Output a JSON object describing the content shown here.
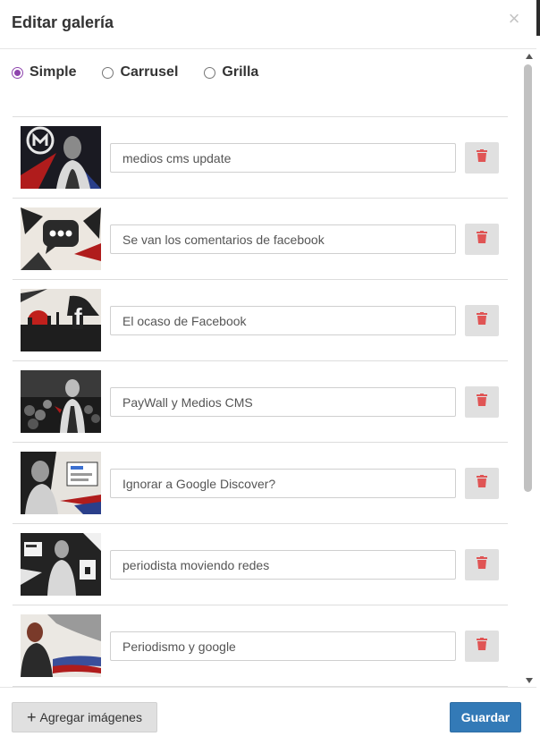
{
  "modal": {
    "title": "Editar galería",
    "close_icon": "×"
  },
  "layout_options": [
    {
      "label": "Simple",
      "checked": true
    },
    {
      "label": "Carrusel",
      "checked": false
    },
    {
      "label": "Grilla",
      "checked": false
    }
  ],
  "items": [
    {
      "caption": "medios cms update"
    },
    {
      "caption": "Se van los comentarios de facebook"
    },
    {
      "caption": "El ocaso de Facebook"
    },
    {
      "caption": "PayWall y Medios CMS"
    },
    {
      "caption": "Ignorar a Google Discover?"
    },
    {
      "caption": "periodista moviendo redes"
    },
    {
      "caption": "Periodismo y google"
    }
  ],
  "footer": {
    "add_label": "Agregar imágenes",
    "save_label": "Guardar"
  },
  "colors": {
    "accent_radio": "#8e44ad",
    "primary_button": "#337ab7",
    "delete_icon": "#e05555"
  },
  "icons": {
    "close": "close-icon",
    "delete": "trash-icon",
    "add": "plus-icon"
  }
}
